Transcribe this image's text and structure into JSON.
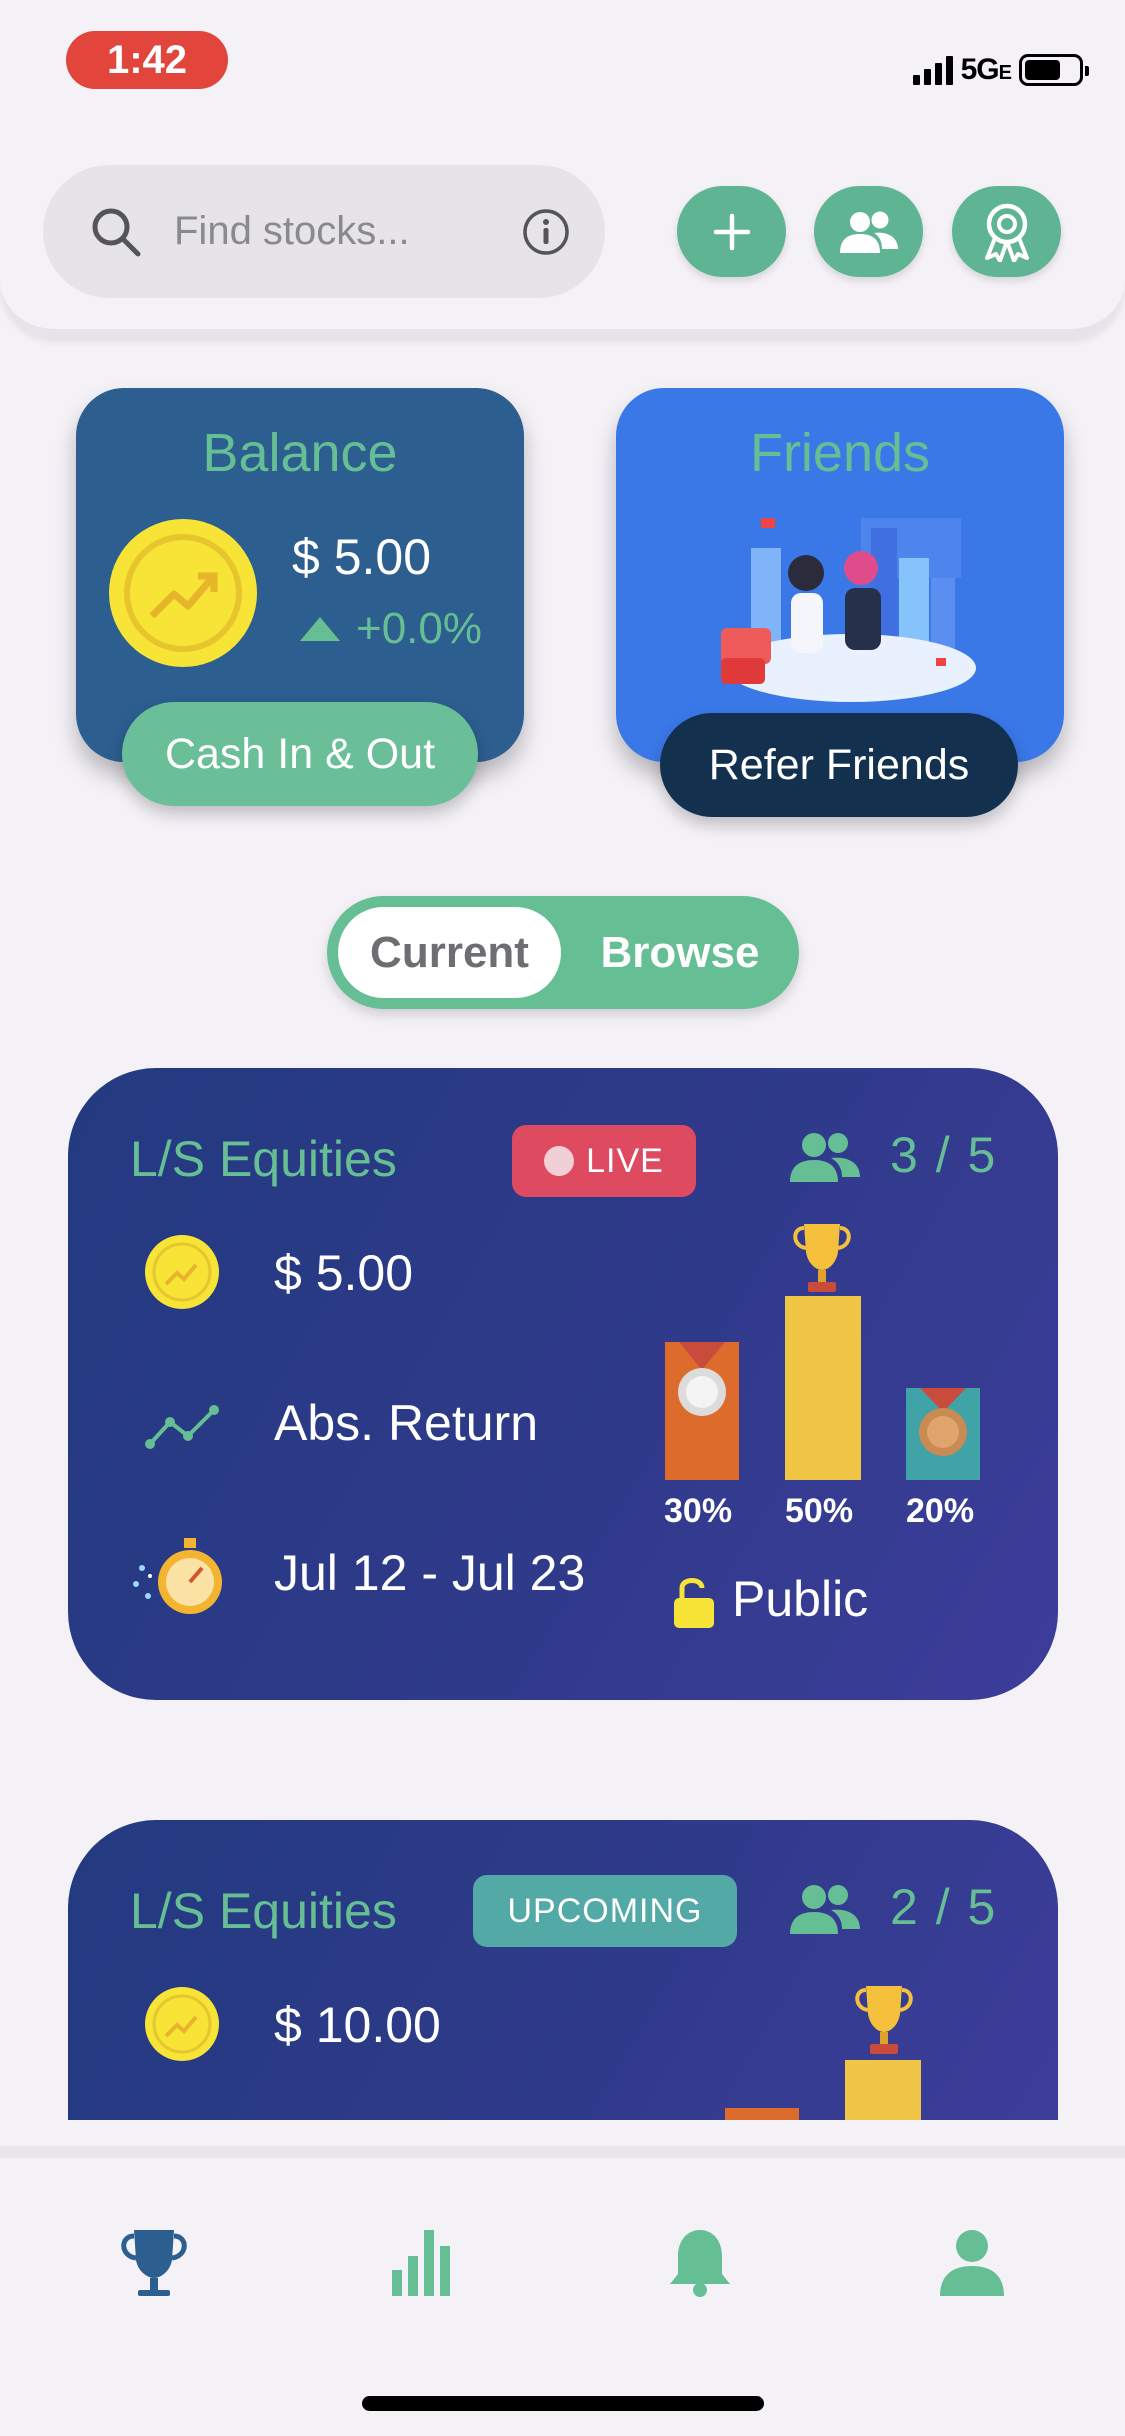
{
  "status_bar": {
    "time": "1:42",
    "network": "5G",
    "network_suffix": "E"
  },
  "header": {
    "search": {
      "placeholder": "Find stocks..."
    },
    "buttons": [
      "add-icon",
      "friends-icon",
      "badge-icon"
    ]
  },
  "balance_card": {
    "title": "Balance",
    "amount": "$ 5.00",
    "change": "+0.0%",
    "action": "Cash In & Out"
  },
  "friends_card": {
    "title": "Friends",
    "action": "Refer Friends"
  },
  "toggle": {
    "options": [
      "Current",
      "Browse"
    ],
    "selected": "Current"
  },
  "contests": [
    {
      "title": "L/S Equities",
      "status": "LIVE",
      "participants": "3 / 5",
      "entry": "$ 5.00",
      "metric": "Abs. Return",
      "dates": "Jul 12 - Jul 23",
      "prizes": [
        {
          "place": "second",
          "pct": "30%",
          "medal": "silver"
        },
        {
          "place": "first",
          "pct": "50%",
          "medal": "trophy"
        },
        {
          "place": "third",
          "pct": "20%",
          "medal": "bronze"
        }
      ],
      "visibility": "Public"
    },
    {
      "title": "L/S Equities",
      "status": "UPCOMING",
      "participants": "2 / 5",
      "entry": "$ 10.00"
    }
  ],
  "tabbar": {
    "tabs": [
      "trophy-icon",
      "bar-chart-icon",
      "bell-icon",
      "profile-icon"
    ],
    "active": "trophy-icon",
    "colors": {
      "active": "#2c5e8f",
      "inactive": "#66be94"
    }
  },
  "colors": {
    "accent_green": "#66be94",
    "balance_card": "#2c5e8f",
    "friends_card": "#3a78e8",
    "refer_pill": "#13314f",
    "contest_card": "#2f3a8a",
    "live_badge": "#de4a60",
    "upcoming_badge": "#52a9a6",
    "status_time": "#e2453c"
  }
}
